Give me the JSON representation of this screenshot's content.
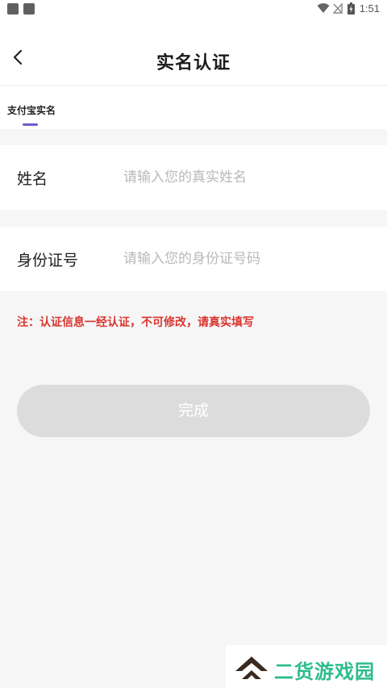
{
  "status_bar": {
    "time": "1:51"
  },
  "header": {
    "title": "实名认证"
  },
  "tabs": [
    {
      "label": "支付宝实名",
      "active": true
    }
  ],
  "form": {
    "name": {
      "label": "姓名",
      "placeholder": "请输入您的真实姓名"
    },
    "id_number": {
      "label": "身份证号",
      "placeholder": "请输入您的身份证号码"
    }
  },
  "notice": "注：认证信息一经认证，不可修改，请真实填写",
  "submit_label": "完成",
  "watermark": {
    "text": "二货游戏园"
  },
  "colors": {
    "accent": "#6d5bd0",
    "warning": "#d9362e",
    "button_disabled": "#dcdcdc",
    "watermark_green": "#2dbd8a",
    "watermark_dark": "#3a2a20"
  }
}
